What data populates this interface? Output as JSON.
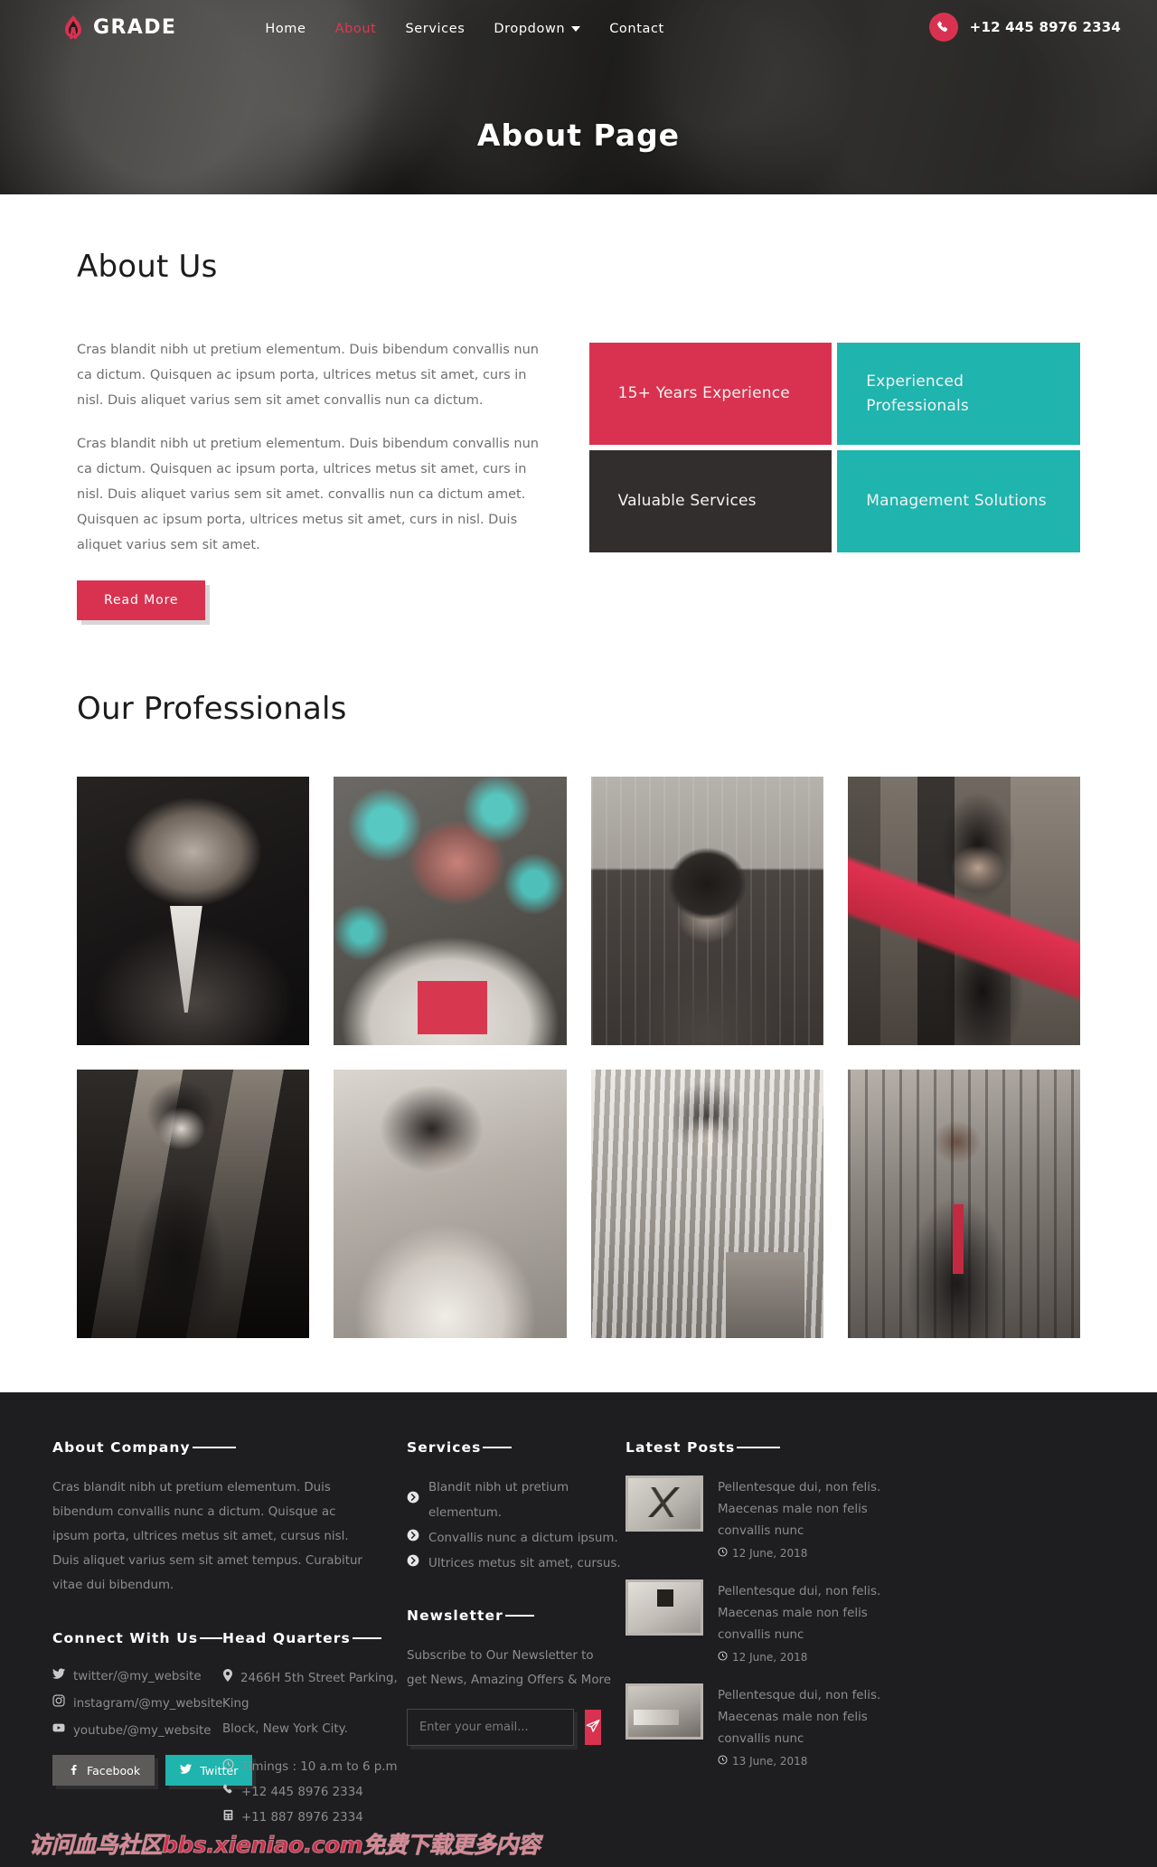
{
  "nav": {
    "brand": "GRADE",
    "brand_icon": "flame-logo-icon",
    "items": [
      {
        "label": "Home",
        "active": false
      },
      {
        "label": "About",
        "active": true
      },
      {
        "label": "Services",
        "active": false
      },
      {
        "label": "Dropdown",
        "active": false,
        "has_caret": true
      },
      {
        "label": "Contact",
        "active": false
      }
    ],
    "phone": "+12 445 8976 2334",
    "phone_icon": "phone-icon",
    "accent": "#d93250"
  },
  "hero": {
    "title": "About Page"
  },
  "about": {
    "title": "About Us",
    "paragraphs": [
      "Cras blandit nibh ut pretium elementum. Duis bibendum convallis nun ca dictum. Quisquen ac ipsum porta, ultrices metus sit amet, curs in nisl. Duis aliquet varius sem sit amet convallis nun ca dictum.",
      "Cras blandit nibh ut pretium elementum. Duis bibendum convallis nun ca dictum. Quisquen ac ipsum porta, ultrices metus sit amet, curs in nisl. Duis aliquet varius sem sit amet. convallis nun ca dictum amet. Quisquen ac ipsum porta, ultrices metus sit amet, curs in nisl. Duis aliquet varius sem sit amet."
    ],
    "read_more": "Read More",
    "stats": [
      {
        "label": "15+ Years Experience",
        "color": "#d93250"
      },
      {
        "label": "Experienced Professionals",
        "color": "#1fb4ad"
      },
      {
        "label": "Valuable Services",
        "color": "#322e2d"
      },
      {
        "label": "Management Solutions",
        "color": "#1fb4ad"
      }
    ]
  },
  "professionals": {
    "title": "Our Professionals",
    "members": [
      {
        "name": "team-member-1"
      },
      {
        "name": "team-member-2"
      },
      {
        "name": "team-member-3"
      },
      {
        "name": "team-member-4"
      },
      {
        "name": "team-member-5"
      },
      {
        "name": "team-member-6"
      },
      {
        "name": "team-member-7"
      },
      {
        "name": "team-member-8"
      }
    ]
  },
  "footer": {
    "about": {
      "heading": "About Company",
      "text": "Cras blandit nibh ut pretium elementum. Duis bibendum convallis nunc a dictum. Quisque ac ipsum porta, ultrices metus sit amet, cursus nisl. Duis aliquet varius sem sit amet tempus. Curabitur vitae dui bibendum."
    },
    "connect": {
      "heading": "Connect With Us",
      "links": [
        {
          "label": "twitter/@my_website",
          "icon": "twitter-icon"
        },
        {
          "label": "instagram/@my_website",
          "icon": "instagram-icon"
        },
        {
          "label": "youtube/@my_website",
          "icon": "youtube-icon"
        }
      ],
      "buttons": [
        {
          "label": "Facebook",
          "icon": "facebook-icon",
          "color": "#5d5a5a"
        },
        {
          "label": "Twitter",
          "icon": "twitter-icon",
          "color": "#1fb4ad"
        }
      ]
    },
    "headquarters": {
      "heading": "Head Quarters",
      "address_line1": "2466H 5th Street Parking,",
      "address_line2": "King",
      "address_line3": "Block, New York City.",
      "timings": "Timings : 10 a.m to 6 p.m",
      "phone": "+12 445 8976 2334",
      "fax": "+11 887 8976 2334"
    },
    "services": {
      "heading": "Services",
      "items": [
        "Blandit nibh ut pretium elementum.",
        "Convallis nunc a dictum ipsum.",
        "Ultrices metus sit amet, cursus."
      ]
    },
    "newsletter": {
      "heading": "Newsletter",
      "text": "Subscribe to Our Newsletter to get News, Amazing Offers & More",
      "placeholder": "Enter your email...",
      "submit_icon": "send-icon"
    },
    "latest_posts": {
      "heading": "Latest Posts",
      "posts": [
        {
          "title": "Pellentesque dui, non felis. Maecenas male non felis convallis nunc",
          "date": "12 June, 2018",
          "thumb": "post-thumb-pens"
        },
        {
          "title": "Pellentesque dui, non felis. Maecenas male non felis convallis nunc",
          "date": "12 June, 2018",
          "thumb": "post-thumb-desk"
        },
        {
          "title": "Pellentesque dui, non felis. Maecenas male non felis convallis nunc",
          "date": "13 June, 2018",
          "thumb": "post-thumb-workspace"
        }
      ]
    },
    "watermark": "访问血鸟社区bbs.xieniao.com免费下载更多内容"
  }
}
